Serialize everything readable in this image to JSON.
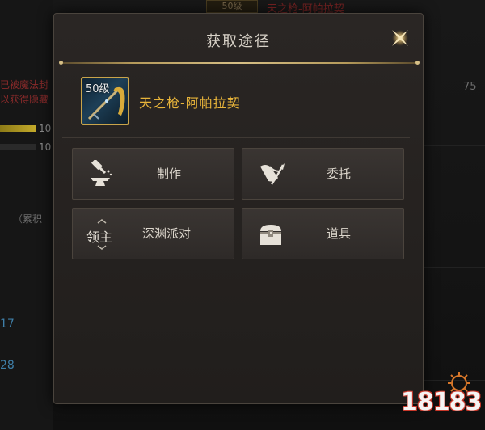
{
  "dialog": {
    "title": "获取途径",
    "item": {
      "level_badge": "50级",
      "name": "天之枪-阿帕拉契"
    },
    "sources": [
      {
        "label": "制作",
        "icon": "anvil-hammer-icon"
      },
      {
        "label": "委托",
        "icon": "scroll-quill-icon"
      },
      {
        "label": "深渊派对",
        "icon": "lord-boss-icon",
        "icon_text": "领主"
      },
      {
        "label": "道具",
        "icon": "treasure-chest-icon"
      }
    ]
  },
  "background": {
    "top_item": "天之枪-阿帕拉契",
    "top_badge": "50级",
    "left_texts": [
      "已被魔法封",
      "以获得隐藏"
    ],
    "left_numbers": [
      "10",
      "10"
    ],
    "left_bracket": "（累积",
    "blue_numbers": [
      "17",
      "28"
    ],
    "right_number": "75"
  },
  "watermark": {
    "text": "18183"
  },
  "colors": {
    "gold": "#e8b43a",
    "frame": "#c9a44a"
  }
}
